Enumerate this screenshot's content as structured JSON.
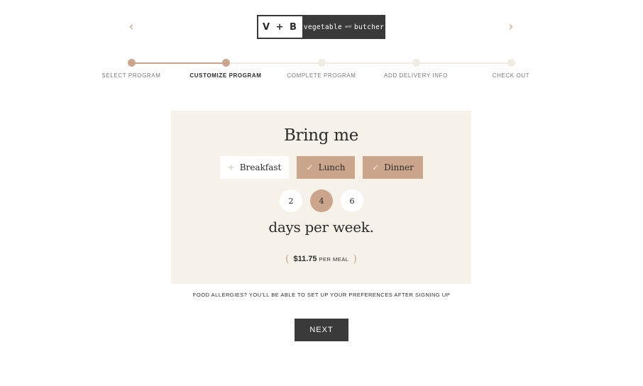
{
  "nav": {
    "prev_icon": "chevron-left-icon",
    "next_icon": "chevron-right-icon",
    "prev_glyph": "‹",
    "next_glyph": "›"
  },
  "logo": {
    "mark": "V + B",
    "text_left": "vegetable",
    "text_and": "and",
    "text_right": "butcher"
  },
  "progress": {
    "steps": [
      {
        "label": "SELECT PROGRAM",
        "state": "done"
      },
      {
        "label": "CUSTOMIZE PROGRAM",
        "state": "active"
      },
      {
        "label": "COMPLETE PROGRAM",
        "state": "pending"
      },
      {
        "label": "ADD DELIVERY INFO",
        "state": "pending"
      },
      {
        "label": "CHECK OUT",
        "state": "pending"
      }
    ]
  },
  "form": {
    "title": "Bring me",
    "meals": [
      {
        "label": "Breakfast",
        "selected": false,
        "icon": "plus-icon",
        "glyph": "+"
      },
      {
        "label": "Lunch",
        "selected": true,
        "icon": "check-icon",
        "glyph": "✓"
      },
      {
        "label": "Dinner",
        "selected": true,
        "icon": "check-icon",
        "glyph": "✓"
      }
    ],
    "days": [
      {
        "value": "2",
        "selected": false
      },
      {
        "value": "4",
        "selected": true
      },
      {
        "value": "6",
        "selected": false
      }
    ],
    "days_suffix": "days per week.",
    "price": {
      "open": "(",
      "amount": "$11.75",
      "unit": "PER MEAL",
      "close": ")"
    }
  },
  "allergy_note": "FOOD ALLERGIES? YOU'LL BE ABLE TO SET UP YOUR PREFERENCES AFTER SIGNING UP",
  "next_button": "NEXT",
  "colors": {
    "accent": "#cba68c",
    "panel": "#f6f2ea",
    "dark": "#3a3a3a",
    "track": "#f1ebe3"
  }
}
